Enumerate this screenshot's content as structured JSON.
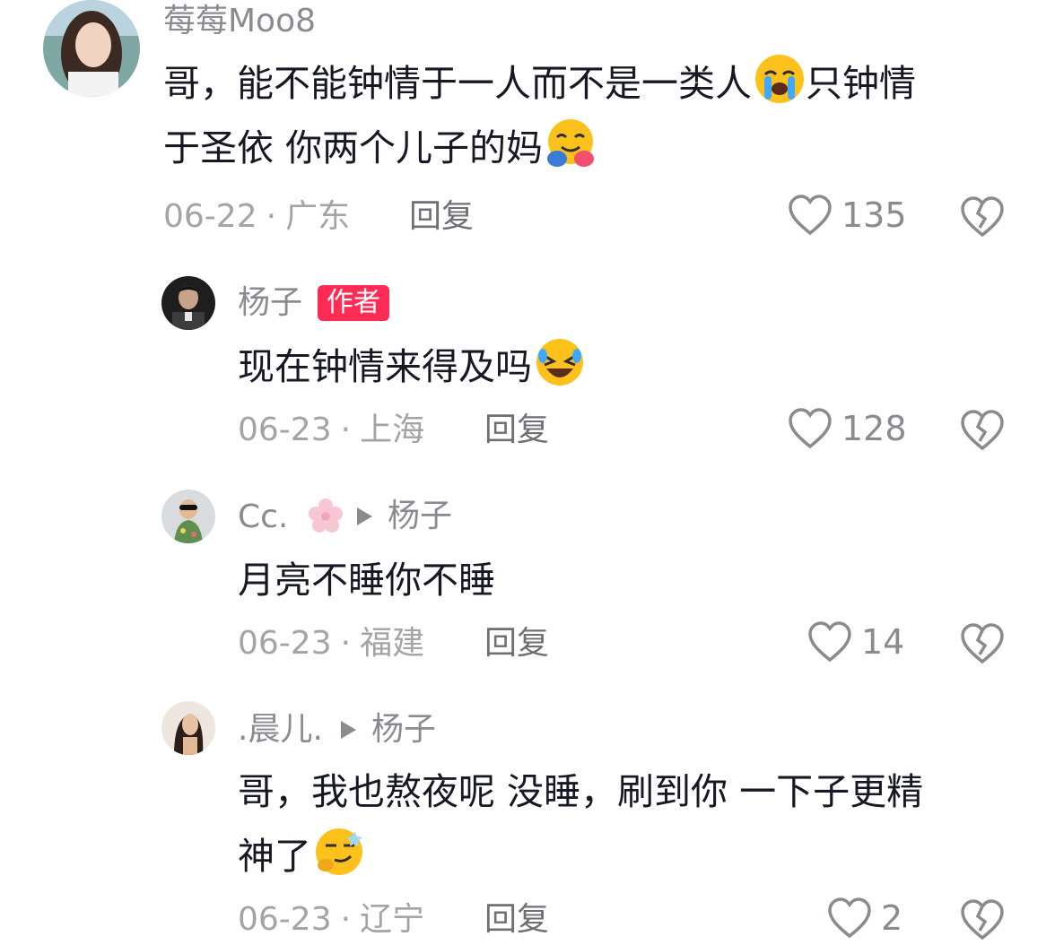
{
  "comments": [
    {
      "username": "莓莓Moo8",
      "text_lines": [
        "哥，能不能钟情于一人而不是一类人",
        "只钟情",
        "于圣依 你两个儿子的妈"
      ],
      "date": "06-22",
      "location": "广东",
      "reply_label": "回复",
      "likes": "135"
    },
    {
      "username": "杨子",
      "badge": "作者",
      "text_lines": [
        "现在钟情来得及吗"
      ],
      "date": "06-23",
      "location": "上海",
      "reply_label": "回复",
      "likes": "128"
    },
    {
      "username": "Cc.",
      "reply_to": "杨子",
      "text_lines": [
        "月亮不睡你不睡"
      ],
      "date": "06-23",
      "location": "福建",
      "reply_label": "回复",
      "likes": "14"
    },
    {
      "username": ".晨儿.",
      "reply_to": "杨子",
      "text_lines": [
        "哥，我也熬夜呢 没睡，刷到你 一下子更精",
        "神了"
      ],
      "date": "06-23",
      "location": "辽宁",
      "reply_label": "回复",
      "likes": "2"
    }
  ],
  "icons": {
    "like": "heart-outline-icon",
    "dislike": "broken-heart-icon",
    "emoji_1": "loudly-crying-face-emoji",
    "emoji_2": "smiling-face-with-hearts-hug-emoji",
    "emoji_3": "rolling-on-floor-laughing-emoji",
    "emoji_4": "thinking-smirk-face-emoji",
    "flower": "cherry-blossom-icon"
  },
  "colors": {
    "author_badge": "#fe2c55",
    "meta": "#a3a4a8",
    "text": "#161823"
  }
}
